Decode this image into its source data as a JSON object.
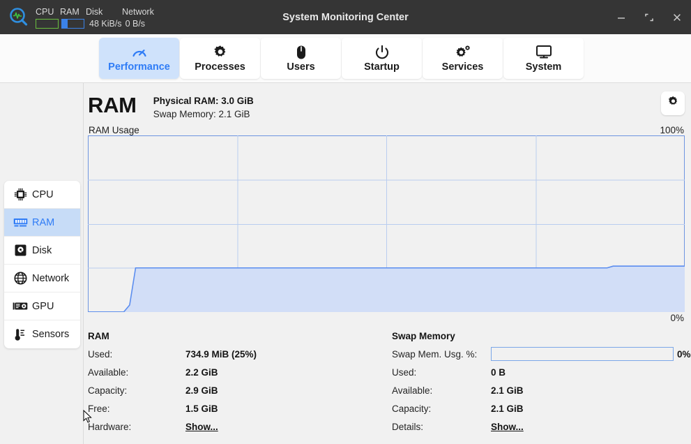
{
  "titlebar": {
    "app_icon": "magnifier-pulse-icon",
    "title": "System Monitoring Center",
    "indicators": {
      "cpu_label": "CPU",
      "ram_label": "RAM",
      "disk_label": "Disk",
      "network_label": "Network",
      "cpu_bar_percent": 0,
      "ram_bar_percent": 25,
      "disk_io": "48 KiB/s",
      "network_io": "0 B/s"
    },
    "controls": {
      "minimize": "minimize-icon",
      "maximize": "maximize-icon",
      "close": "close-icon"
    }
  },
  "tabs": [
    {
      "label": "Performance",
      "icon": "gauge-icon",
      "active": true
    },
    {
      "label": "Processes",
      "icon": "gear-icon",
      "active": false
    },
    {
      "label": "Users",
      "icon": "mouse-icon",
      "active": false
    },
    {
      "label": "Startup",
      "icon": "power-icon",
      "active": false
    },
    {
      "label": "Services",
      "icon": "gears-icon",
      "active": false
    },
    {
      "label": "System",
      "icon": "monitor-icon",
      "active": false
    }
  ],
  "sidebar": {
    "items": [
      {
        "label": "CPU",
        "icon": "cpu-chip-icon",
        "active": false
      },
      {
        "label": "RAM",
        "icon": "memory-stick-icon",
        "active": true
      },
      {
        "label": "Disk",
        "icon": "hard-disk-icon",
        "active": false
      },
      {
        "label": "Network",
        "icon": "globe-icon",
        "active": false
      },
      {
        "label": "GPU",
        "icon": "gpu-card-icon",
        "active": false
      },
      {
        "label": "Sensors",
        "icon": "thermometer-icon",
        "active": false
      }
    ]
  },
  "main": {
    "page_title": "RAM",
    "physical_ram": "Physical RAM: 3.0 GiB",
    "swap_memory": "Swap Memory: 2.1 GiB",
    "settings_icon": "gear-icon",
    "graph_label": "RAM Usage",
    "graph_top_label": "100%",
    "graph_bottom_label": "0%"
  },
  "chart_data": {
    "type": "area",
    "title": "RAM Usage",
    "ylabel": "",
    "xlabel": "",
    "ylim": [
      0,
      100
    ],
    "y_tick_labels": [
      "100%",
      "0%"
    ],
    "grid": true,
    "grid_columns": 4,
    "grid_rows": 4,
    "line_color": "#5b8def",
    "fill_color": "#d2def7",
    "series": [
      {
        "name": "RAM Usage %",
        "x": [
          0,
          6,
          7,
          8,
          20,
          40,
          60,
          75,
          87,
          88,
          92,
          100
        ],
        "values": [
          0,
          0,
          4,
          25,
          25,
          25,
          25,
          25,
          25,
          26,
          26,
          26
        ]
      }
    ]
  },
  "stats": {
    "ram": {
      "heading": "RAM",
      "rows": [
        {
          "key": "Used:",
          "value": "734.9 MiB (25%)",
          "link": false
        },
        {
          "key": "Available:",
          "value": "2.2 GiB",
          "link": false
        },
        {
          "key": "Capacity:",
          "value": "2.9 GiB",
          "link": false
        },
        {
          "key": "Free:",
          "value": "1.5 GiB",
          "link": false
        },
        {
          "key": "Hardware:",
          "value": "Show...",
          "link": true
        }
      ]
    },
    "swap": {
      "heading": "Swap Memory",
      "usage_key": "Swap Mem. Usg. %:",
      "usage_percent": 0,
      "usage_percent_label": "0%",
      "rows": [
        {
          "key": "Used:",
          "value": "0 B",
          "link": false
        },
        {
          "key": "Available:",
          "value": "2.1 GiB",
          "link": false
        },
        {
          "key": "Capacity:",
          "value": "2.1 GiB",
          "link": false
        },
        {
          "key": "Details:",
          "value": "Show...",
          "link": true
        }
      ]
    }
  },
  "colors": {
    "accent_blue": "#2f7cf6",
    "active_tab_bg": "#cfe2fb",
    "titlebar_bg": "#353535",
    "content_bg": "#f1f1f1",
    "cpu_green": "#6abf3f"
  }
}
